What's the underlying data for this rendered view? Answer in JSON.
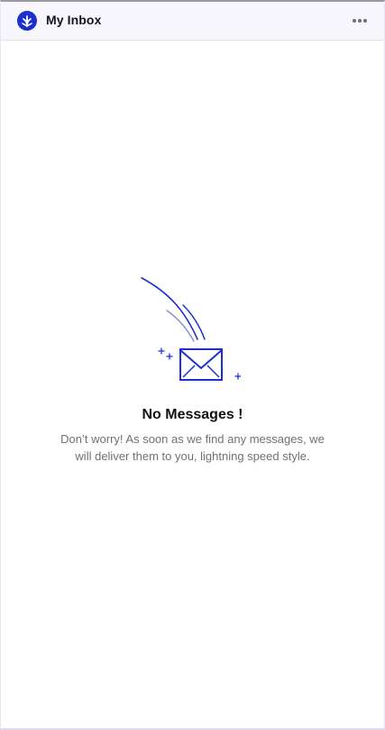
{
  "header": {
    "title": "My Inbox",
    "logo_icon": "brand-logo-icon",
    "menu_icon": "more-horizontal-icon"
  },
  "empty_state": {
    "title": "No Messages !",
    "description": "Don’t worry! As soon as we find any messages, we will deliver them to you, lightning speed style.",
    "illustration_icon": "flying-envelope-icon"
  },
  "colors": {
    "accent": "#1b2fd0",
    "header_bg": "#f7f6fc",
    "text_primary": "#101116",
    "text_secondary": "#6f7079"
  }
}
